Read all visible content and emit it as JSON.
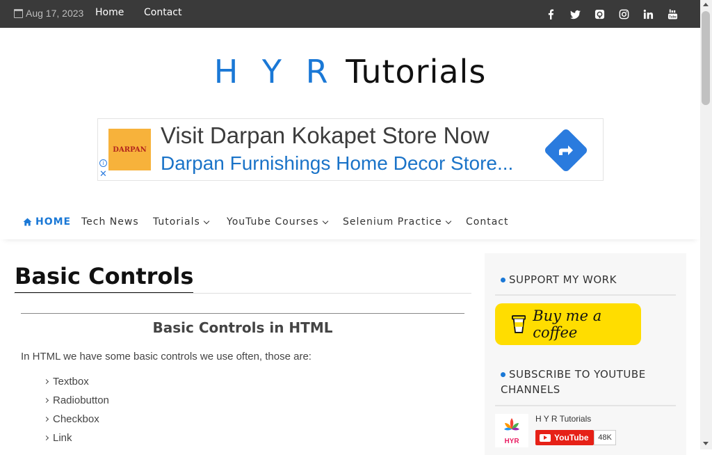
{
  "topbar": {
    "date": "Aug 17, 2023",
    "links": [
      "Home",
      "Contact"
    ],
    "social_icons": [
      "facebook-icon",
      "twitter-icon",
      "github-icon",
      "instagram-icon",
      "linkedin-icon",
      "youtube-icon"
    ]
  },
  "logo": {
    "part1": "H Y R",
    "part2": "Tutorials"
  },
  "ad": {
    "logo_text": "DARPAN",
    "headline": "Visit Darpan Kokapet Store Now",
    "subline": "Darpan Furnishings Home Decor Store...",
    "info_glyph": "i",
    "close_glyph": "✕"
  },
  "nav": {
    "items": [
      "HOME",
      "Tech News",
      "Tutorials",
      "YouTube Courses",
      "Selenium Practice",
      "Contact"
    ]
  },
  "main": {
    "title": "Basic Controls",
    "subtitle": "Basic Controls in HTML",
    "intro": "In HTML we have some basic controls we use often, those are:",
    "list": [
      "Textbox",
      "Radiobutton",
      "Checkbox",
      "Link"
    ]
  },
  "sidebar": {
    "support_title": "SUPPORT MY WORK",
    "coffee_label": "Buy me a coffee",
    "subscribe_title_line1": "SUBSCRIBE TO YOUTUBE",
    "subscribe_title_line2": "CHANNELS",
    "channel_name": "H Y R Tutorials",
    "channel_thumb_text": "HYR",
    "youtube_label": "YouTube",
    "subscriber_count": "48K"
  },
  "colors": {
    "accent": "#1a78d6",
    "topbar": "#3a3a3a",
    "coffee": "#ffdd00",
    "youtube": "#e62117"
  }
}
